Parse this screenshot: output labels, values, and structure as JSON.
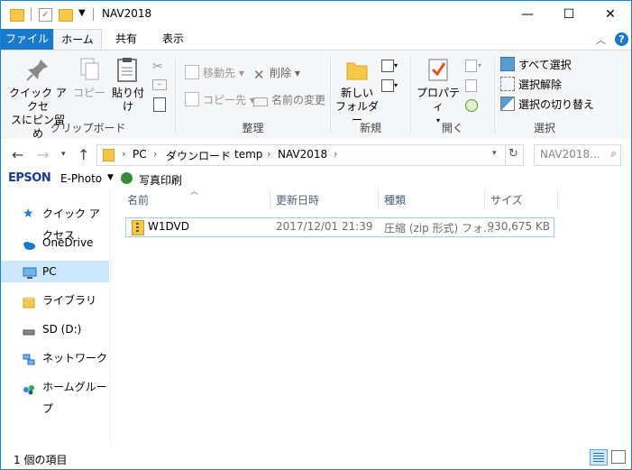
{
  "window": {
    "title": "NAV2018",
    "minimize_glyph": "—",
    "maximize_glyph": "☐",
    "close_glyph": "✕"
  },
  "ribbon_tabs": [
    "ファイル",
    "ホーム",
    "共有",
    "表示"
  ],
  "ribbon": {
    "clipboard": {
      "pin_label_1": "クイック アクセ",
      "pin_label_2": "スにピン留め",
      "copy_label": "コピー",
      "paste_label": "貼り付け",
      "group_label": "クリップボード"
    },
    "organize": {
      "move_label": "移動先",
      "copy_to_label": "コピー先",
      "delete_label": "削除",
      "rename_label": "名前の変更",
      "group_label": "整理"
    },
    "new": {
      "new_folder_1": "新しい",
      "new_folder_2": "フォルダー",
      "group_label": "新規"
    },
    "open": {
      "properties_label": "プロパティ",
      "group_label": "開く"
    },
    "select": {
      "select_all": "すべて選択",
      "select_none": "選択解除",
      "invert": "選択の切り替え",
      "group_label": "選択"
    }
  },
  "address": {
    "crumbs": [
      "PC",
      "ダウンロード",
      "temp",
      "NAV2018"
    ],
    "search_placeholder": "NAV2018..."
  },
  "epson": {
    "brand": "EPSON",
    "app": "E-Photo",
    "print_label": "写真印刷"
  },
  "nav_pane": {
    "items": [
      "クイック アクセス",
      "OneDrive",
      "PC",
      "ライブラリ",
      "SD (D:)",
      "ネットワーク",
      "ホームグループ"
    ],
    "selected": "PC"
  },
  "columns": [
    "名前",
    "更新日時",
    "種類",
    "サイズ"
  ],
  "files": [
    {
      "name": "W1DVD",
      "modified": "2017/12/01 21:39",
      "type": "圧縮 (zip 形式) フォ...",
      "size": "930,675 KB"
    }
  ],
  "status": {
    "item_count": "1 個の項目"
  },
  "colors": {
    "file_tab": "#1979ca",
    "selection": "#cce8ff",
    "accent": "#1883d7"
  }
}
